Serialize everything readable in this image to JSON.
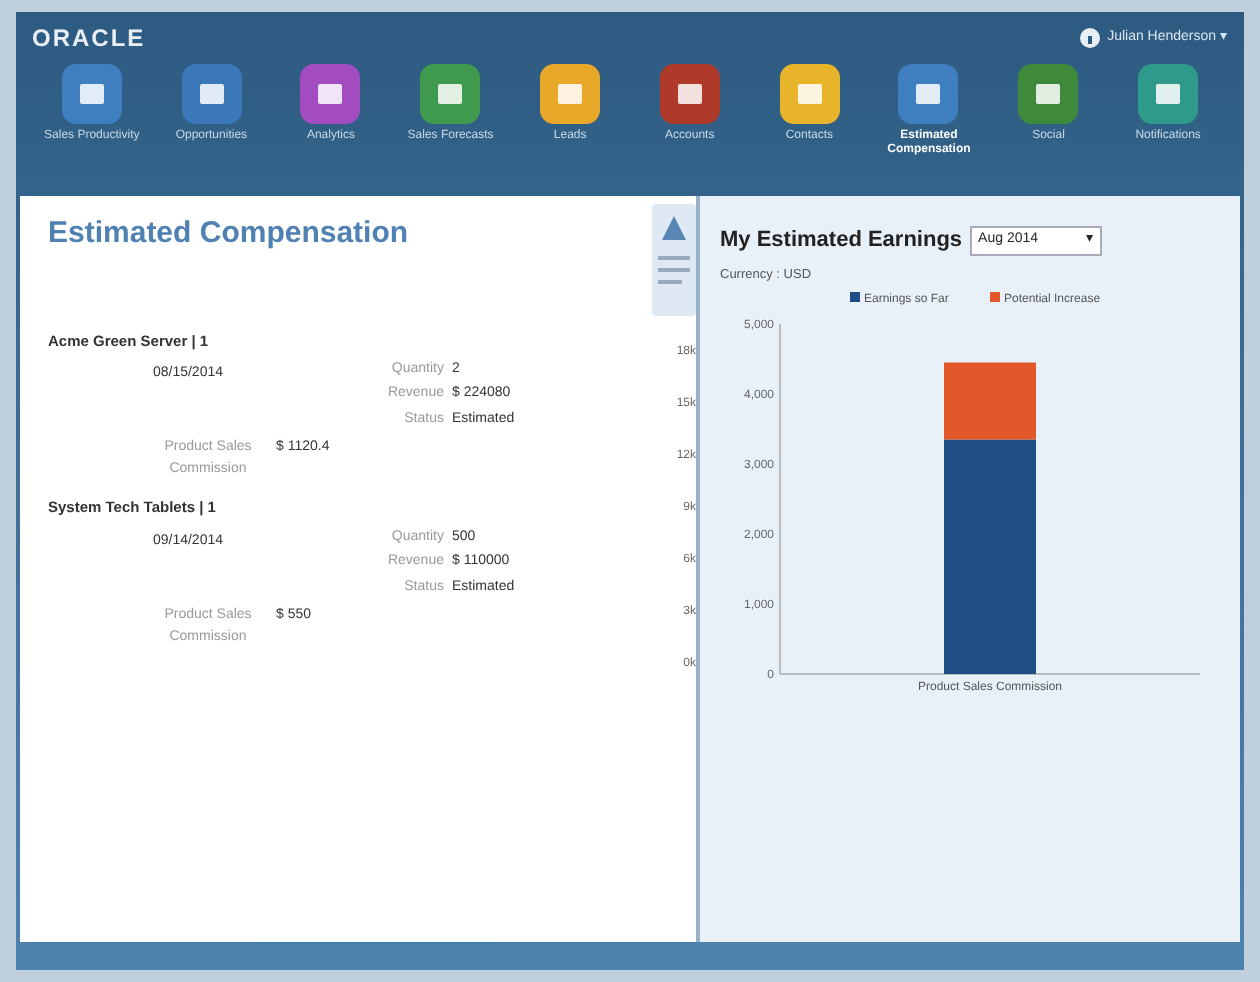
{
  "header": {
    "logo": "ORACLE",
    "user": "Julian Henderson ▾"
  },
  "nav": [
    {
      "label": "Sales Productivity",
      "color": "#3f7fc0",
      "selected": false
    },
    {
      "label": "Opportunities",
      "color": "#3a78b8",
      "selected": false
    },
    {
      "label": "Analytics",
      "color": "#a24cc0",
      "selected": false
    },
    {
      "label": "Sales Forecasts",
      "color": "#3f9a4e",
      "selected": false
    },
    {
      "label": "Leads",
      "color": "#e8a92a",
      "selected": false
    },
    {
      "label": "Accounts",
      "color": "#b03a2a",
      "selected": false
    },
    {
      "label": "Contacts",
      "color": "#e8b52a",
      "selected": false
    },
    {
      "label": "Estimated Compensation",
      "color": "#3f7fc0",
      "selected": true
    },
    {
      "label": "Social",
      "color": "#3f8a3a",
      "selected": false
    },
    {
      "label": "Notifications",
      "color": "#2f9a8a",
      "selected": false
    }
  ],
  "left_panel": {
    "title": "Estimated Compensation",
    "transactions": [
      {
        "name": "Acme Green Server | 1",
        "date": "08/15/2014",
        "fields": [
          {
            "label": "Quantity",
            "value": "2"
          },
          {
            "label": "Revenue",
            "value": "$ 224080"
          },
          {
            "label": "Status",
            "value": "Estimated"
          }
        ],
        "commission_label": "Product Sales Commission",
        "commission": "$ 1120.4"
      },
      {
        "name": "System Tech Tablets | 1",
        "date": "09/14/2014",
        "fields": [
          {
            "label": "Quantity",
            "value": "500"
          },
          {
            "label": "Revenue",
            "value": "$ 110000"
          },
          {
            "label": "Status",
            "value": "Estimated"
          }
        ],
        "commission_label": "Product Sales Commission",
        "commission": "$ 550"
      }
    ],
    "side_axis_ticks": [
      "18k",
      "15k",
      "12k",
      "9k",
      "6k",
      "3k",
      "0k"
    ]
  },
  "right_panel": {
    "title": "My Estimated Earnings",
    "period": "Aug 2014",
    "period_arrow": "▾",
    "currency": "Currency : USD",
    "chart_data": {
      "type": "bar",
      "stacked": true,
      "legend": true,
      "categories": [
        "Product Sales Commission"
      ],
      "series": [
        {
          "name": "Earnings so Far",
          "color": "#1f4e86",
          "values": [
            3350
          ]
        },
        {
          "name": "Potential Increase",
          "color": "#e2582a",
          "values": [
            1100
          ]
        }
      ],
      "ylim": [
        0,
        5000
      ],
      "yticks": [
        {
          "value": 0,
          "label": "0"
        },
        {
          "value": 1000,
          "label": "1,000"
        },
        {
          "value": 2000,
          "label": "2,000"
        },
        {
          "value": 3000,
          "label": "3,000"
        },
        {
          "value": 4000,
          "label": "4,000"
        },
        {
          "value": 5000,
          "label": "5,000"
        }
      ]
    }
  }
}
